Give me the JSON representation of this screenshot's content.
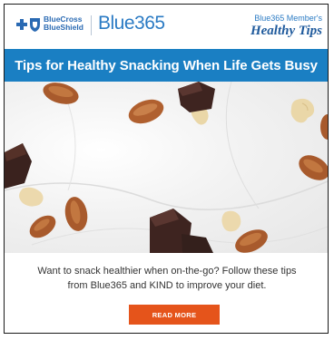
{
  "header": {
    "bcbs_line1": "BlueCross",
    "bcbs_line2": "BlueShield",
    "brand": "Blue365",
    "tagline_top": "Blue365 Member's",
    "tagline_main": "Healthy Tips"
  },
  "banner": {
    "title": "Tips for Healthy Snacking When Life Gets Busy"
  },
  "hero": {
    "icon": "mixed-nuts-and-chocolate-photo"
  },
  "body": {
    "text": "Want to snack healthier when on-the-go? Follow these tips from Blue365 and KIND to improve your diet."
  },
  "cta": {
    "label": "READ MORE"
  },
  "colors": {
    "banner": "#1a7fc3",
    "brand_blue": "#2b7bc4",
    "cta": "#e5541b"
  }
}
